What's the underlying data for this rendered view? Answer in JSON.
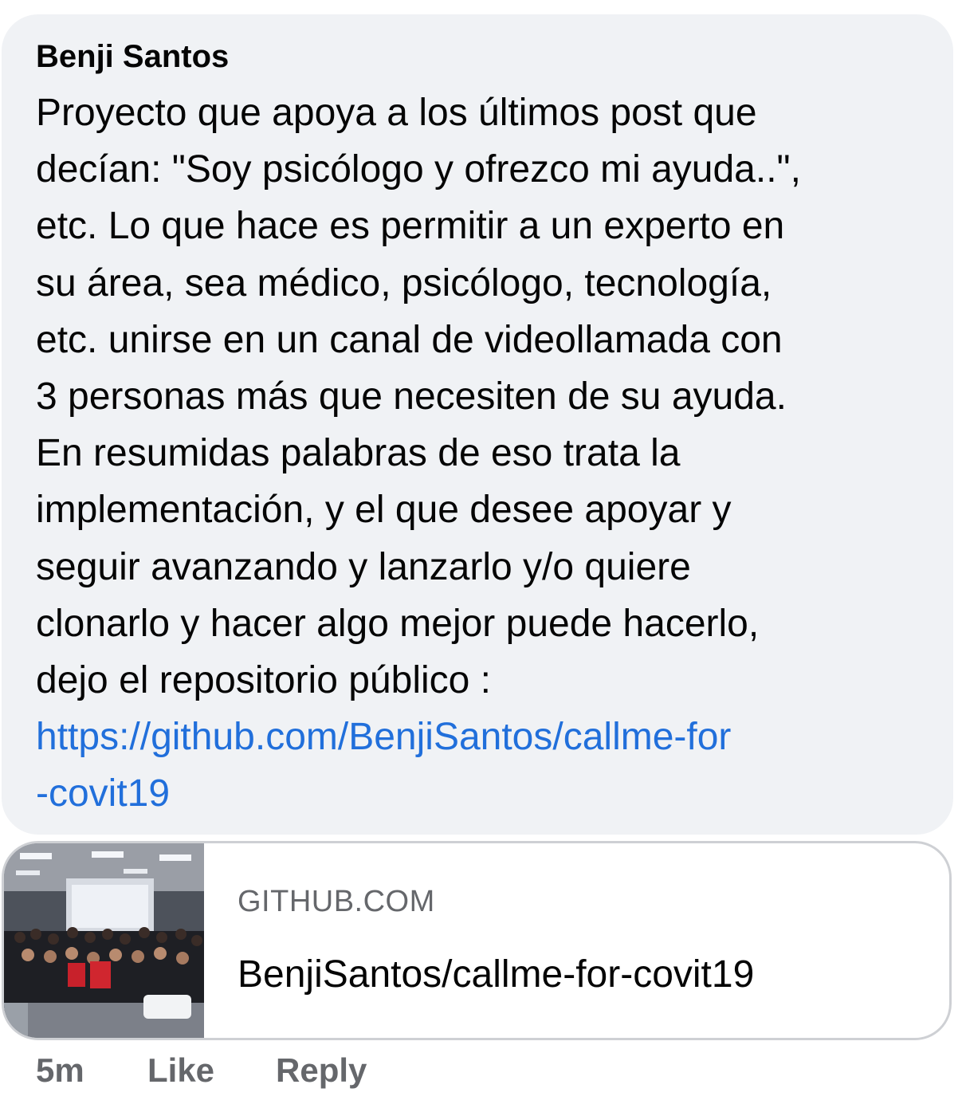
{
  "comment": {
    "author": "Benji Santos",
    "text_lines": [
      "Proyecto que apoya a los últimos post que",
      "decían: \"Soy psicólogo y ofrezco mi ayuda..\",",
      "etc.  Lo que hace es permitir a un experto en",
      "su área, sea médico, psicólogo, tecnología,",
      "etc. unirse en un canal de videollamada con",
      "3 personas más que necesiten de su ayuda.",
      "En resumidas palabras de eso trata la",
      "implementación, y el que desee apoyar y",
      "seguir avanzando y lanzarlo y/o quiere",
      "clonarlo y hacer algo mejor puede hacerlo,",
      "dejo el repositorio público :"
    ],
    "link_lines": [
      "https://github.com/BenjiSantos/callme-for",
      "-covit19"
    ]
  },
  "link_preview": {
    "domain": "GITHUB.COM",
    "title": "BenjiSantos/callme-for-covit19",
    "thumbnail_icon": "group-photo-thumbnail"
  },
  "actions": {
    "time": "5m",
    "like": "Like",
    "reply": "Reply"
  },
  "colors": {
    "bubble_bg": "#f0f2f5",
    "link": "#216fdb",
    "secondary_text": "#65676b",
    "card_border": "#ced0d4"
  }
}
